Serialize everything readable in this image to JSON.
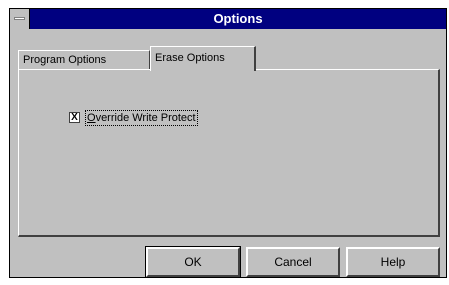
{
  "window": {
    "title": "Options"
  },
  "tabs": [
    {
      "label": "Program Options",
      "active": false
    },
    {
      "label": "Erase Options",
      "active": true
    }
  ],
  "erase_options": {
    "override_write_protect": {
      "mnemonic": "O",
      "label_rest": "verride Write Protect",
      "checked": true,
      "check_glyph": "X"
    }
  },
  "buttons": {
    "ok": "OK",
    "cancel": "Cancel",
    "help": "Help"
  },
  "icons": {
    "system_menu": "system-menu-icon"
  }
}
